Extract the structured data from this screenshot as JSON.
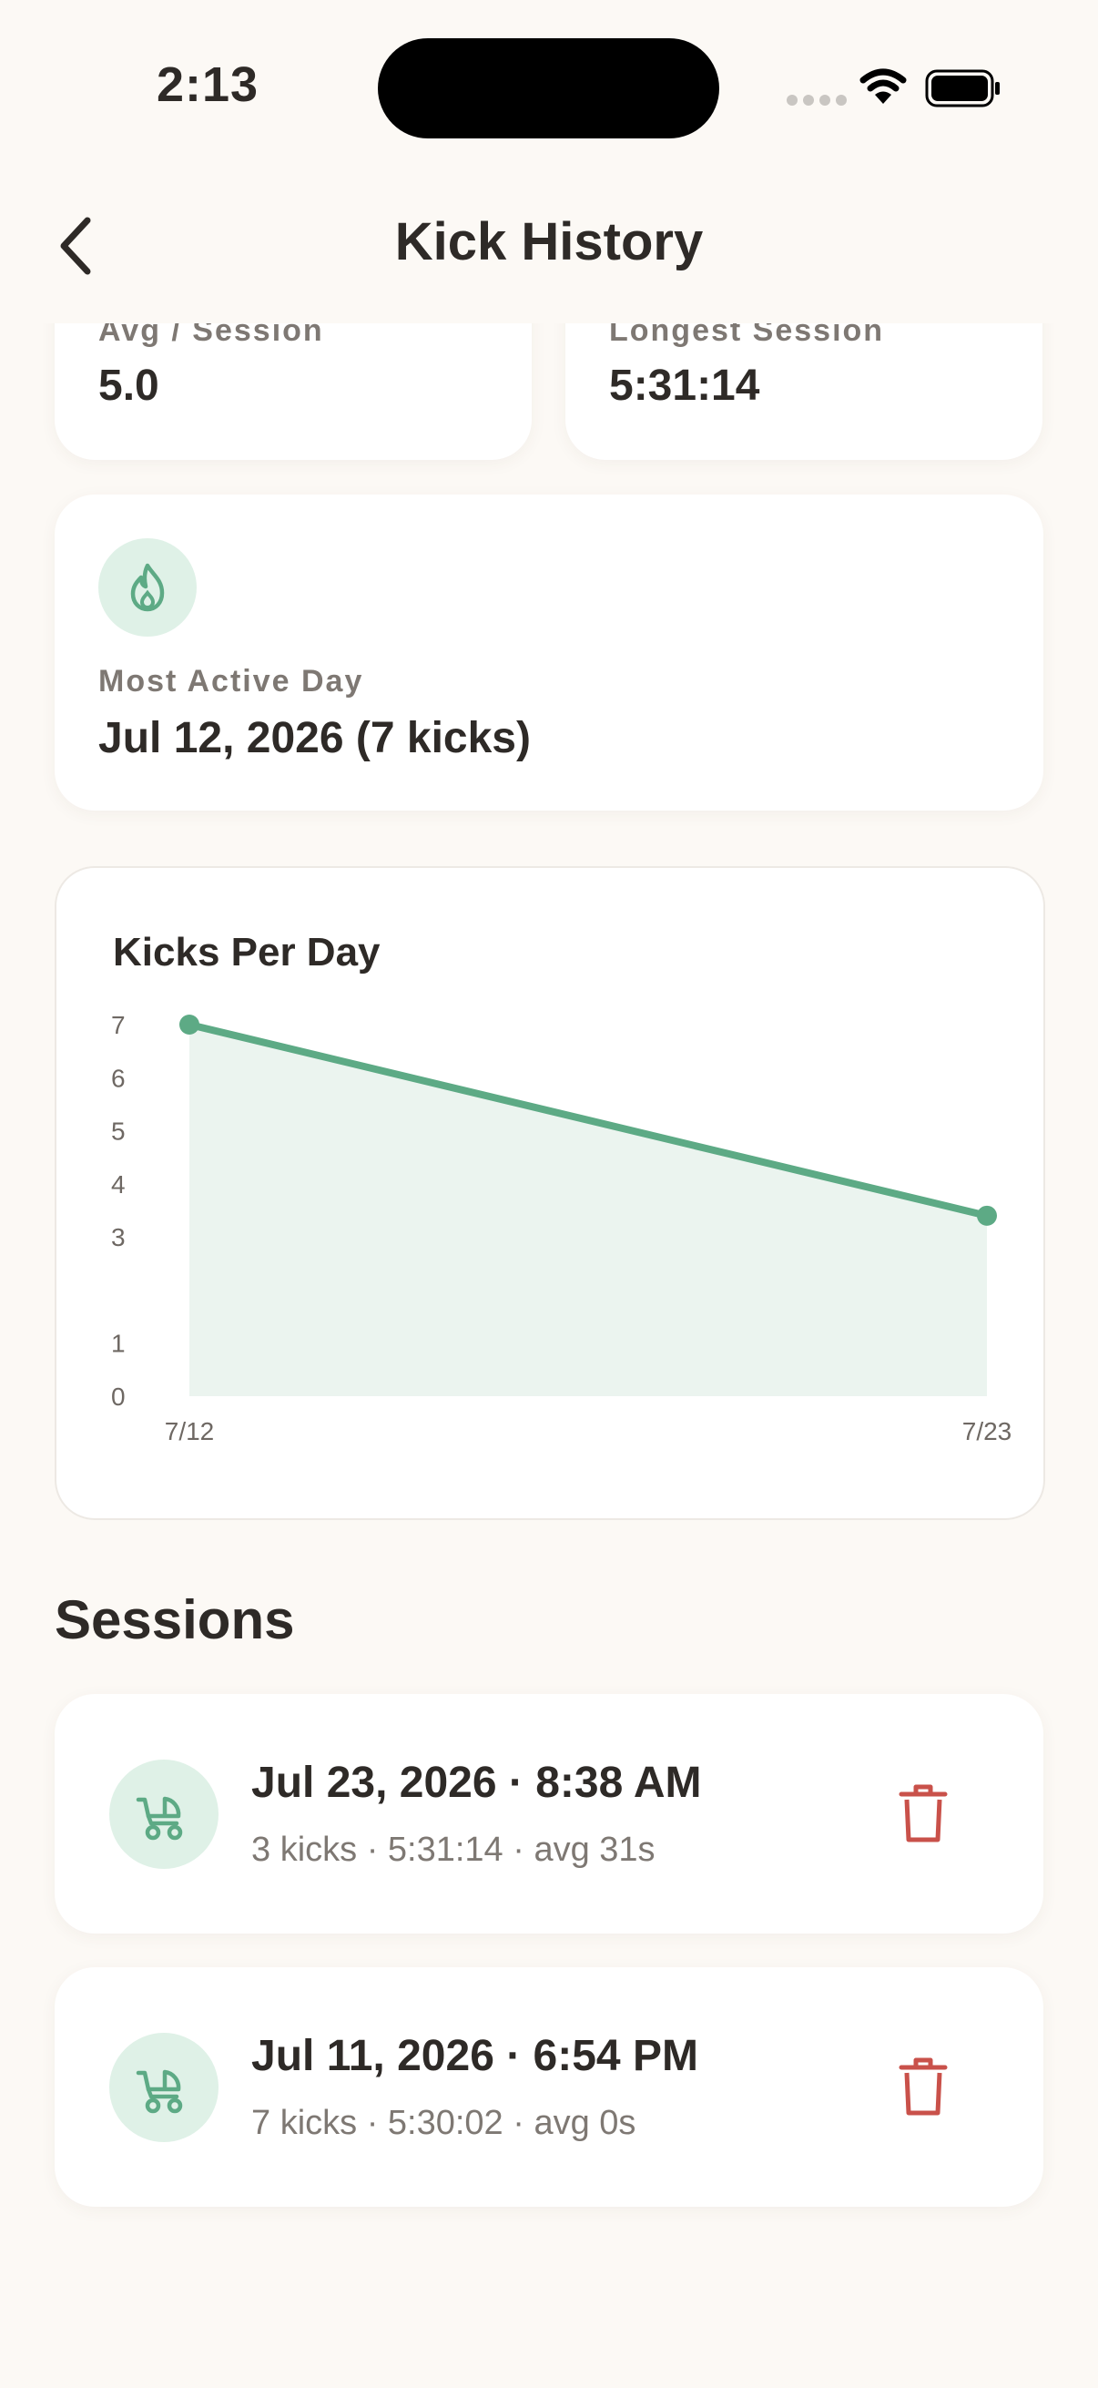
{
  "status_bar": {
    "time": "2:13"
  },
  "header": {
    "title": "Kick History"
  },
  "stats": {
    "avg_label": "Avg / Session",
    "avg_value": "5.0",
    "longest_label": "Longest Session",
    "longest_value": "5:31:14"
  },
  "most_active": {
    "label": "Most Active Day",
    "value": "Jul 12, 2026 (7 kicks)"
  },
  "chart_data": {
    "type": "area",
    "title": "Kicks Per Day",
    "x": [
      "7/12",
      "7/23"
    ],
    "values": [
      7,
      3.4
    ],
    "yticks": [
      0,
      1,
      3,
      4,
      5,
      6,
      7
    ],
    "ylim": [
      0,
      7
    ],
    "grid": false,
    "color": "#5DAA85",
    "fill": "#EBF4EF"
  },
  "sessions": {
    "title": "Sessions",
    "items": [
      {
        "title": "Jul 23, 2026 · 8:38 AM",
        "subtitle": "3 kicks · 5:31:14 · avg 31s"
      },
      {
        "title": "Jul 11, 2026 · 6:54 PM",
        "subtitle": "7 kicks · 5:30:02 · avg 0s"
      }
    ]
  },
  "colors": {
    "accent": "#5DAA85",
    "accent_light": "#DFF1E7",
    "danger": "#C9514A",
    "background": "#FCF9F5"
  },
  "icons": {
    "back": "chevron-left-icon",
    "fire": "flame-icon",
    "stroller": "stroller-icon",
    "delete": "trash-icon"
  }
}
